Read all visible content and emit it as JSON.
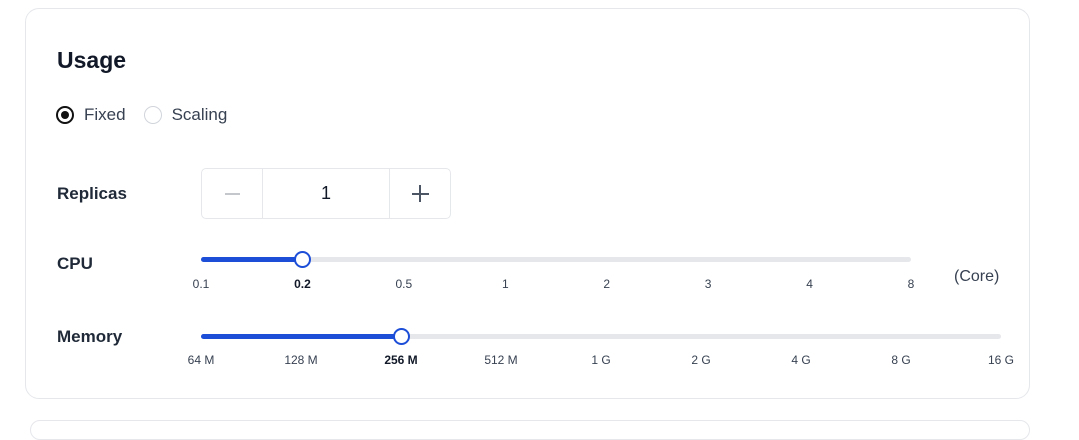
{
  "usage": {
    "title": "Usage",
    "mode_options": [
      {
        "label": "Fixed",
        "checked": true
      },
      {
        "label": "Scaling",
        "checked": false
      }
    ]
  },
  "replicas": {
    "label": "Replicas",
    "value": "1"
  },
  "cpu": {
    "label": "CPU",
    "ticks": [
      "0.1",
      "0.2",
      "0.5",
      "1",
      "2",
      "3",
      "4",
      "8"
    ],
    "selected": "0.2",
    "selected_index": 1,
    "unit": "(Core)"
  },
  "memory": {
    "label": "Memory",
    "ticks": [
      "64 M",
      "128 M",
      "256 M",
      "512 M",
      "1 G",
      "2 G",
      "4 G",
      "8 G",
      "16 G"
    ],
    "selected": "256 M",
    "selected_index": 2
  },
  "colors": {
    "accent": "#1d4ed8",
    "track": "#e5e7eb"
  }
}
